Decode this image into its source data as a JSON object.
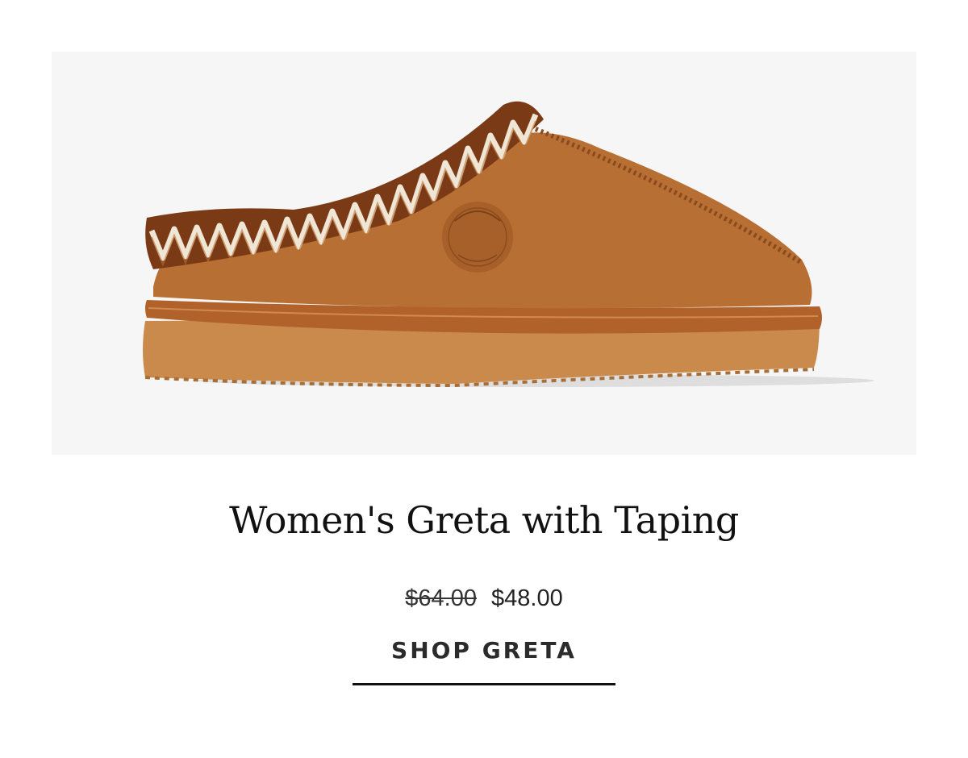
{
  "product": {
    "image_alt": "Women's Greta with Taping slipper in chestnut suede with chevron taping",
    "title": "Women's Greta with Taping",
    "original_price": "$64.00",
    "sale_price": "$48.00",
    "cta_label": "SHOP GRETA"
  },
  "colors": {
    "image_background": "#f6f6f6",
    "suede": "#b86f33",
    "sole": "#c98a4c",
    "taping_dark": "#7a3a16",
    "taping_light": "#efe6d6"
  }
}
